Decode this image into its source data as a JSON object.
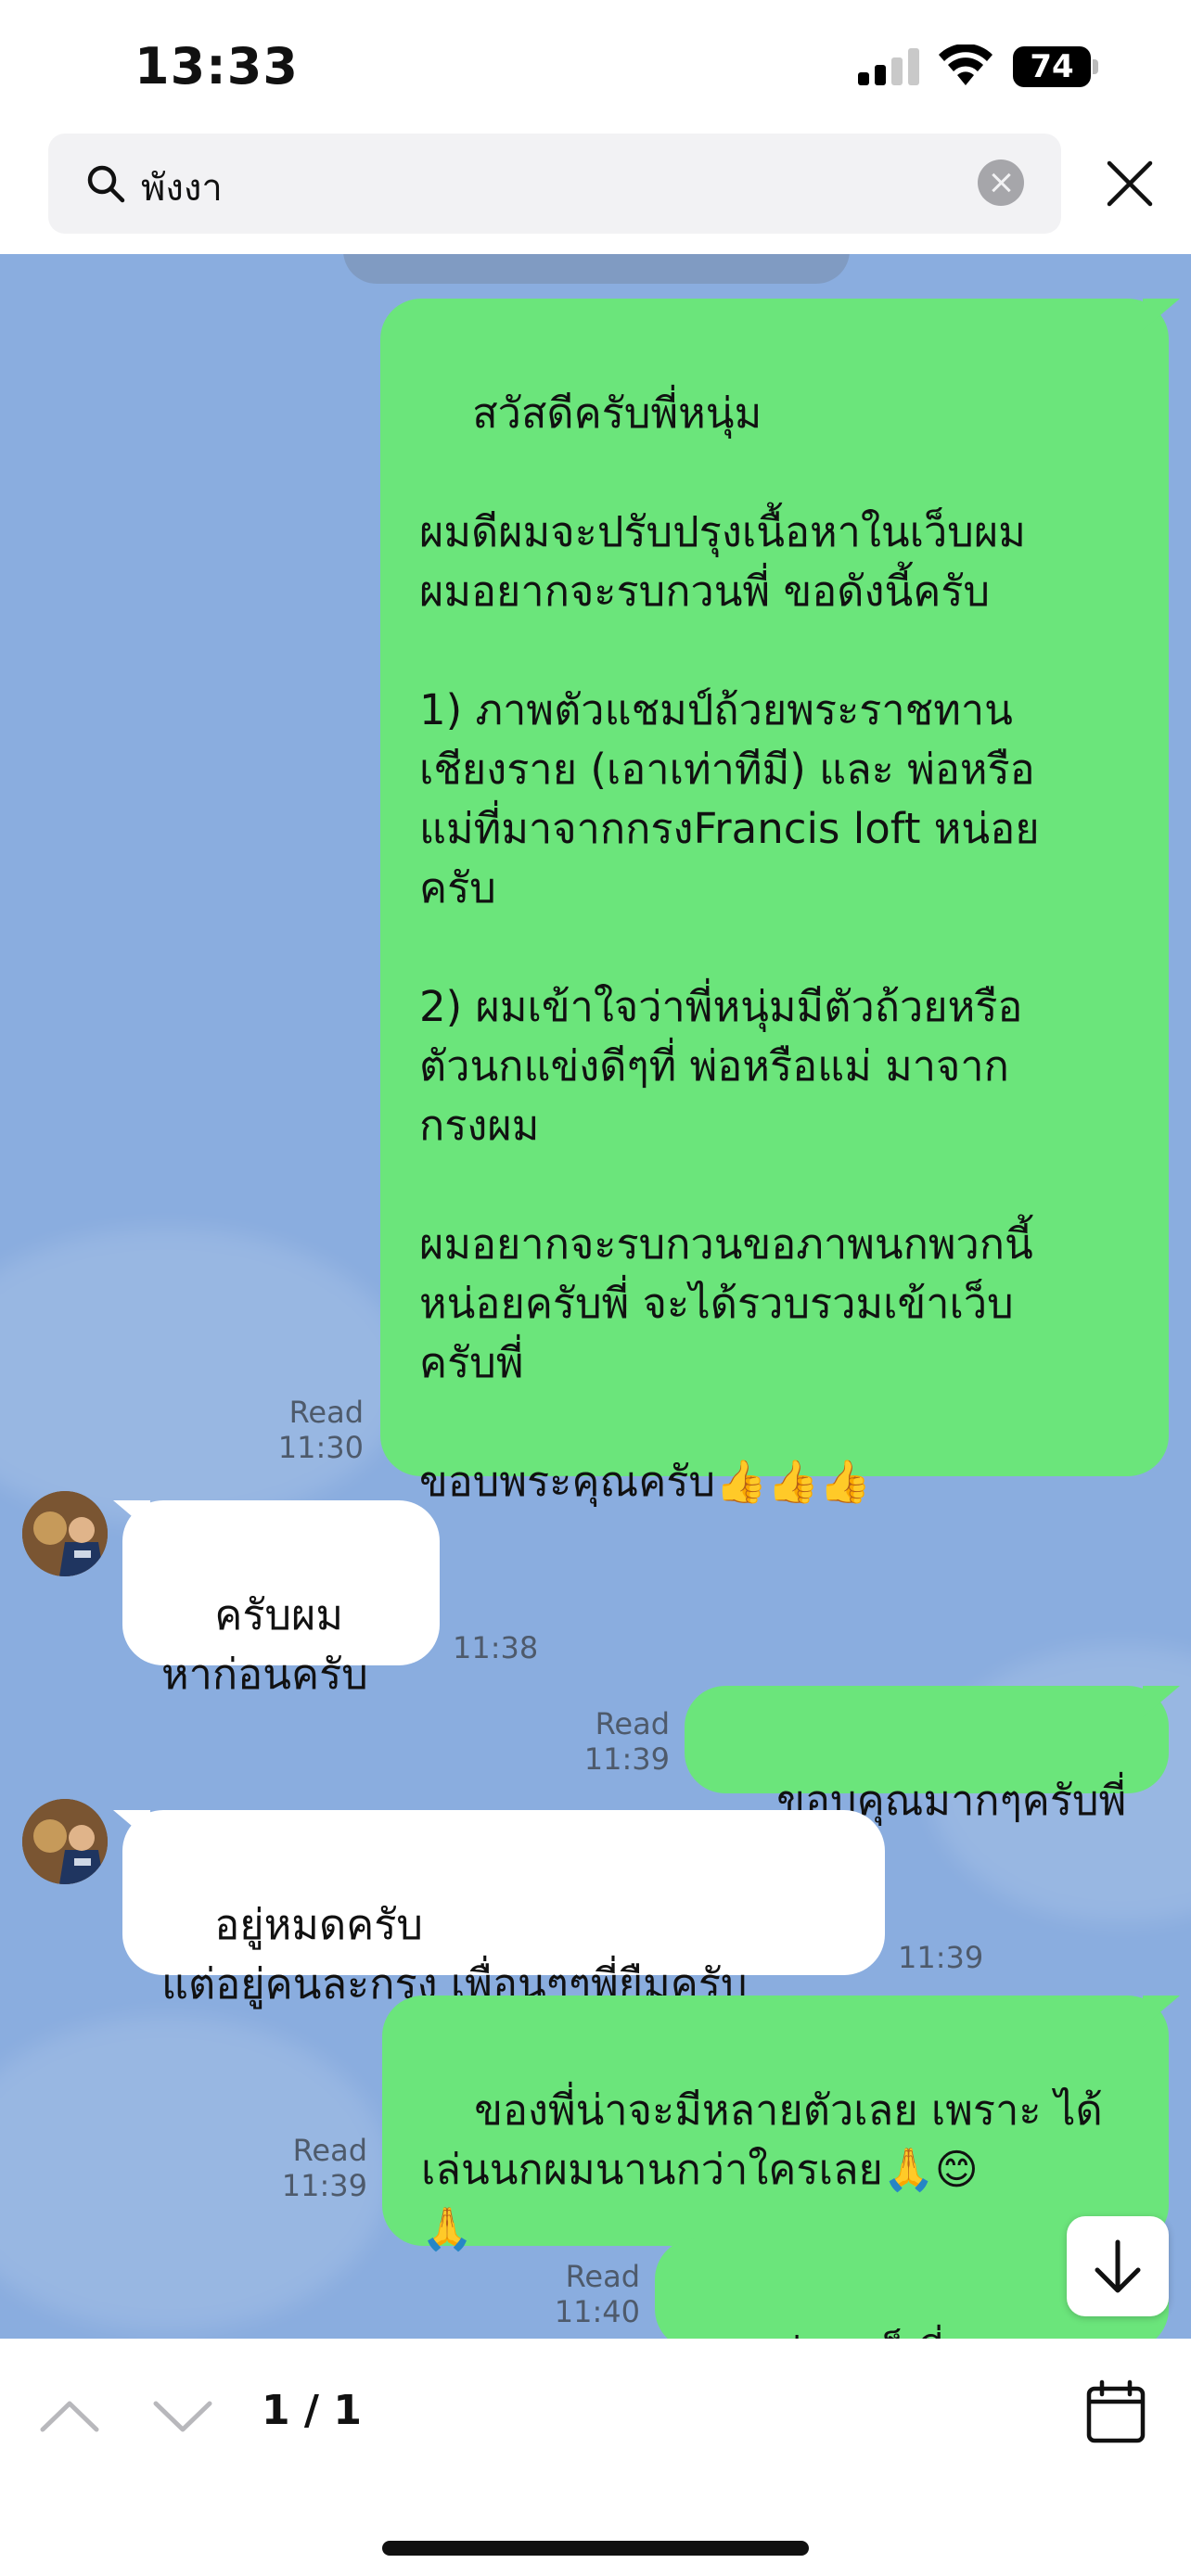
{
  "status_bar": {
    "time": "13:33",
    "battery": "74"
  },
  "search": {
    "query": "พังงา"
  },
  "messages": [
    {
      "direction": "out",
      "text": "สวัสดีครับพี่หนุ่ม\n\nผมดีผมจะปรับปรุงเนื้อหาในเว็บผม\nผมอยากจะรบกวนพี่ ขอดังนี้ครับ\n\n1) ภาพตัวแชมป์ถ้วยพระราชทาน\nเชียงราย (เอาเท่าทีมี) และ พ่อหรือ\nแม่ที่มาจากกรงFrancis loft หน่อย\nครับ\n\n2) ผมเข้าใจว่าพี่หนุ่มมีตัวถ้วยหรือ\nตัวนกแข่งดีๆที่ พ่อหรือแม่ มาจาก\nกรงผม\n\nผมอยากจะรบกวนขอภาพนกพวกนี้\nหน่อยครับพี่ จะได้รวบรวมเข้าเว็บ\nครับพี่\n\nขอบพระคุณครับ👍👍👍",
      "status": "Read",
      "time": "11:30"
    },
    {
      "direction": "in",
      "text": "ครับผม\nหาก่อนครับ",
      "time": "11:38"
    },
    {
      "direction": "out",
      "text": "ขอบคุณมากๆครับพี่",
      "status": "Read",
      "time": "11:39"
    },
    {
      "direction": "in",
      "text": "อยู่หมดครับ\nแต่อยู่คนละกรง เพื่อนๆๆพี่ยืมครับ",
      "time": "11:39"
    },
    {
      "direction": "out",
      "text": "ของพี่น่าจะมีหลายตัวเลย เพราะ ได้\nเล่นนกผมนานกว่าใครเลย🙏😊\n🙏",
      "status": "Read",
      "time": "11:39"
    },
    {
      "direction": "out",
      "text": "แค่ภาพก็เยี่ยมละค",
      "status": "Read",
      "time": "11:40"
    }
  ],
  "bottom_bar": {
    "result_count": "1 / 1"
  },
  "icons": [
    "search-icon",
    "clear-icon",
    "close-icon",
    "scroll-down-icon",
    "chevron-up-icon",
    "chevron-down-icon",
    "calendar-icon"
  ]
}
